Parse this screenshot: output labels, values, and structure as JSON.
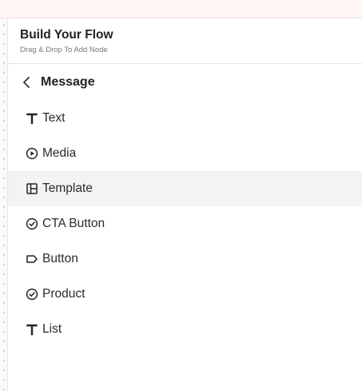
{
  "header": {
    "title": "Build Your Flow",
    "subtitle": "Drag & Drop To Add Node"
  },
  "section": {
    "title": "Message",
    "back_icon": "chevron-left-icon"
  },
  "items": [
    {
      "label": "Text",
      "icon": "text-t-icon"
    },
    {
      "label": "Media",
      "icon": "play-circle-icon"
    },
    {
      "label": "Template",
      "icon": "layout-template-icon",
      "selected": true
    },
    {
      "label": "CTA Button",
      "icon": "check-circle-icon"
    },
    {
      "label": "Button",
      "icon": "tag-label-icon"
    },
    {
      "label": "Product",
      "icon": "check-circle-icon"
    },
    {
      "label": "List",
      "icon": "text-t-icon"
    }
  ],
  "colors": {
    "selected_row": "#f3f3f3",
    "top_strip": "#fff6f4"
  }
}
